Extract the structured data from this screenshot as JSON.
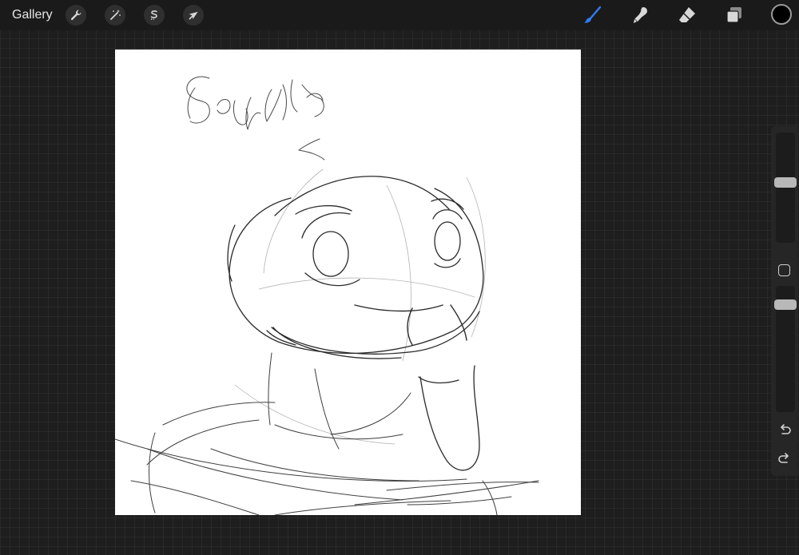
{
  "topbar": {
    "gallery_label": "Gallery",
    "left_tools": [
      {
        "name": "actions",
        "icon": "wrench-icon"
      },
      {
        "name": "adjustments",
        "icon": "magic-wand-icon"
      },
      {
        "name": "selection",
        "icon": "selection-s-icon"
      },
      {
        "name": "transform",
        "icon": "arrow-cursor-icon"
      }
    ],
    "right_tools": [
      {
        "name": "brush",
        "icon": "brush-icon",
        "active": true
      },
      {
        "name": "smudge",
        "icon": "smudge-icon"
      },
      {
        "name": "eraser",
        "icon": "eraser-icon"
      },
      {
        "name": "layers",
        "icon": "layers-icon"
      }
    ],
    "current_color": "#000000"
  },
  "sidebar": {
    "brush_size_level": 0.58,
    "opacity_level": 0.77,
    "modify_button_icon": "square-icon",
    "undo_icon": "undo-icon",
    "redo_icon": "redo-icon"
  },
  "colors": {
    "accent": "#2f7cf6",
    "app_background": "#1e1e1e",
    "canvas": "#ffffff"
  }
}
